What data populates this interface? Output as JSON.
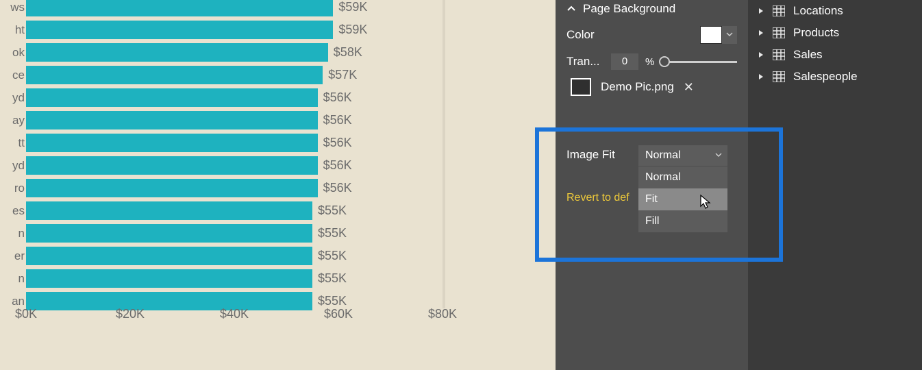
{
  "format_panel": {
    "section_title": "Page Background",
    "color_label": "Color",
    "color_value": "#ffffff",
    "transparency_label": "Tran...",
    "transparency_value": "0",
    "transparency_unit": "%",
    "image_file": "Demo Pic.png",
    "image_fit_label": "Image Fit",
    "image_fit_selected": "Normal",
    "image_fit_options": [
      "Normal",
      "Fit",
      "Fill"
    ],
    "revert_label": "Revert to def"
  },
  "fields_panel": {
    "tables": [
      "Locations",
      "Products",
      "Sales",
      "Salespeople"
    ]
  },
  "chart_data": {
    "type": "bar",
    "orientation": "horizontal",
    "xlabel": "",
    "ylabel": "",
    "xlim": [
      0,
      80
    ],
    "x_ticks": [
      "$0K",
      "$20K",
      "$40K",
      "$60K",
      "$80K"
    ],
    "categories_visible_suffix": [
      "ws",
      "ht",
      "ok",
      "ce",
      "yd",
      "ay",
      "tt",
      "yd",
      "ro",
      "es",
      "n",
      "er",
      "n",
      "an"
    ],
    "values": [
      59,
      59,
      58,
      57,
      56,
      56,
      56,
      56,
      56,
      55,
      55,
      55,
      55,
      55
    ],
    "value_labels": [
      "$59K",
      "$59K",
      "$58K",
      "$57K",
      "$56K",
      "$56K",
      "$56K",
      "$56K",
      "$56K",
      "$55K",
      "$55K",
      "$55K",
      "$55K",
      "$55K"
    ]
  }
}
